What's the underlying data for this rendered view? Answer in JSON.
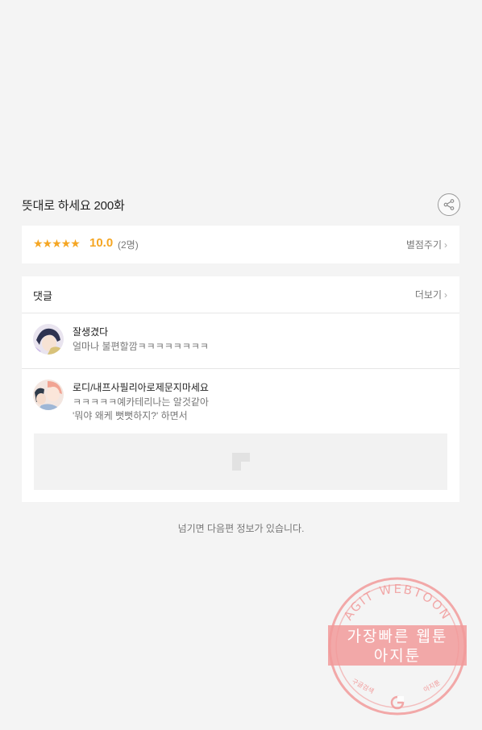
{
  "episode": {
    "title": "뜻대로 하세요 200화"
  },
  "rating": {
    "stars": "★★★★★",
    "score": "10.0",
    "count": "(2명)",
    "rate_link": "별점주기"
  },
  "comments": {
    "title": "댓글",
    "more_link": "더보기",
    "items": [
      {
        "author": "잘생겼다",
        "text": "얼마나 불편할깜ㅋㅋㅋㅋㅋㅋㅋㅋ"
      },
      {
        "author": "로디/내프사필리아로제문지마세요",
        "text_line1": "ㅋㅋㅋㅋㅋ예카테리나는 알것같아",
        "text_line2": "'뭐야 왜케 뻣뻣하지?' 하면서"
      }
    ]
  },
  "footer": {
    "next_info": "넘기면 다음편 정보가 있습니다."
  },
  "watermark": {
    "arc_text": "AGIT WEBTOON",
    "line1": "가장빠른 웹툰",
    "line2": "아지툰",
    "bottom_left": "구글검색",
    "bottom_right": "아지툰"
  },
  "colors": {
    "accent_orange": "#f5a623",
    "watermark_pink": "#f19a9a"
  }
}
